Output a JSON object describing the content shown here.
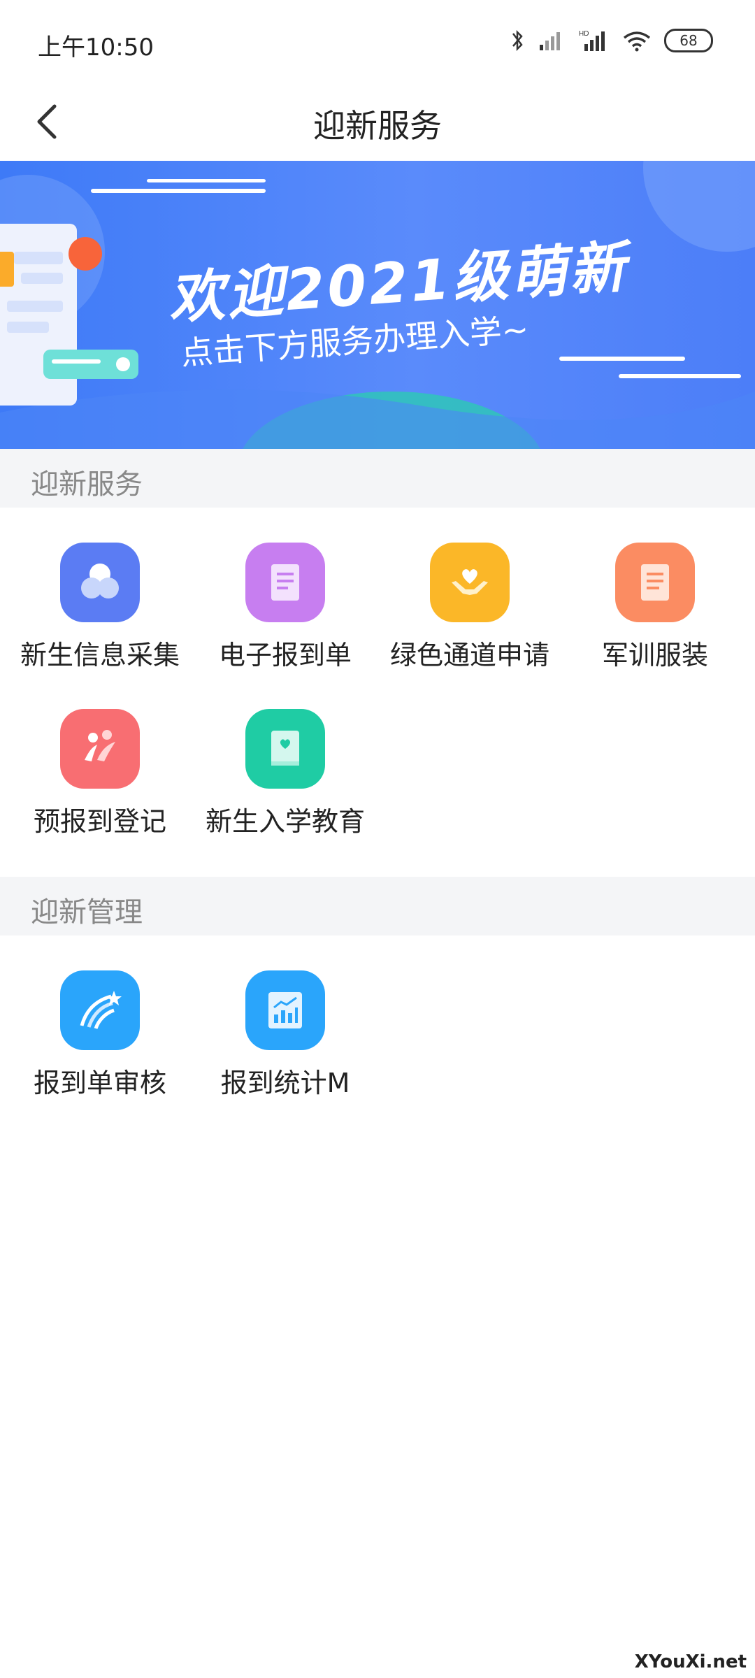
{
  "status_bar": {
    "time": "上午10:50",
    "battery": "68"
  },
  "nav": {
    "title": "迎新服务"
  },
  "banner": {
    "title": "欢迎2021级萌新",
    "subtitle": "点击下方服务办理入学~"
  },
  "sections": {
    "services": {
      "title": "迎新服务",
      "items": [
        {
          "label": "新生信息采集",
          "icon": "circles-icon",
          "color": "#5b7cf3"
        },
        {
          "label": "电子报到单",
          "icon": "document-icon",
          "color": "#c77ef0"
        },
        {
          "label": "绿色通道申请",
          "icon": "heart-hands-icon",
          "color": "#fbb728"
        },
        {
          "label": "军训服装",
          "icon": "scroll-icon",
          "color": "#fb8c62"
        },
        {
          "label": "预报到登记",
          "icon": "people-icon",
          "color": "#f86e72"
        },
        {
          "label": "新生入学教育",
          "icon": "book-heart-icon",
          "color": "#1fcca4"
        }
      ]
    },
    "management": {
      "title": "迎新管理",
      "items": [
        {
          "label": "报到单审核",
          "icon": "shooting-star-icon",
          "color": "#2aa5fb"
        },
        {
          "label": "报到统计M",
          "icon": "chart-icon",
          "color": "#2aa5fb"
        }
      ]
    }
  },
  "watermark": "XYouXi.net"
}
